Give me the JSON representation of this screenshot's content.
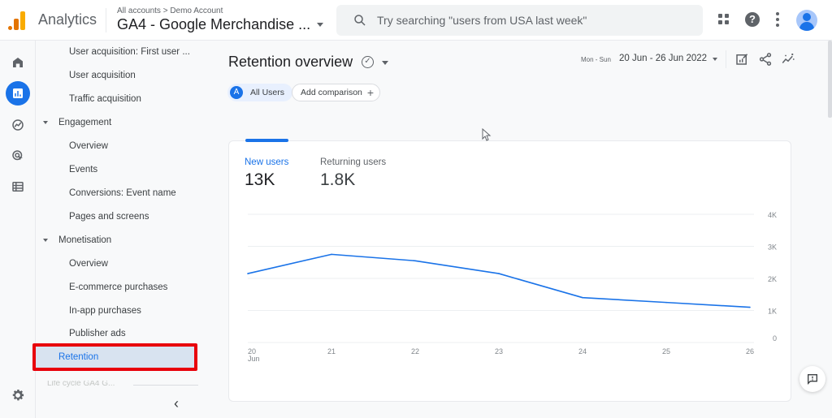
{
  "topbar": {
    "app_name": "Analytics",
    "breadcrumb": "All accounts > Demo Account",
    "property_name": "GA4 - Google Merchandise ...",
    "search_placeholder": "Try searching \"users from USA last week\"",
    "help_glyph": "?",
    "avatar_initial": ""
  },
  "rail": {
    "items": [
      {
        "icon": "home-icon",
        "label": "Home"
      },
      {
        "icon": "reports-icon",
        "label": "Reports",
        "active": true
      },
      {
        "icon": "explore-icon",
        "label": "Explore"
      },
      {
        "icon": "advertising-icon",
        "label": "Advertising"
      },
      {
        "icon": "configure-icon",
        "label": "Configure"
      }
    ],
    "settings_icon": "gear-icon"
  },
  "nav": {
    "items": [
      {
        "label": "User acquisition: First user ...",
        "type": "sub"
      },
      {
        "label": "User acquisition",
        "type": "sub"
      },
      {
        "label": "Traffic acquisition",
        "type": "sub"
      },
      {
        "label": "Engagement",
        "type": "section"
      },
      {
        "label": "Overview",
        "type": "sub"
      },
      {
        "label": "Events",
        "type": "sub"
      },
      {
        "label": "Conversions: Event name",
        "type": "sub"
      },
      {
        "label": "Pages and screens",
        "type": "sub"
      },
      {
        "label": "Monetisation",
        "type": "section"
      },
      {
        "label": "Overview",
        "type": "sub"
      },
      {
        "label": "E-commerce purchases",
        "type": "sub"
      },
      {
        "label": "In-app purchases",
        "type": "sub"
      },
      {
        "label": "Publisher ads",
        "type": "sub"
      },
      {
        "label": "Retention",
        "type": "active"
      }
    ],
    "faded_label": "Life cycle  GA4 G...",
    "collapse_glyph": "‹"
  },
  "main": {
    "title": "Retention overview",
    "title_check_glyph": "✓",
    "comparison_chip": {
      "badge": "A",
      "label": "All Users"
    },
    "add_comparison": {
      "label": "Add comparison",
      "glyph": "+"
    },
    "date_prefix": "Mon - Sun",
    "date_range": "20 Jun - 26 Jun 2022",
    "header_icons": [
      "customize-report-icon",
      "share-icon",
      "insights-icon"
    ]
  },
  "card": {
    "metrics": [
      {
        "label": "New users",
        "value": "13K",
        "active": true
      },
      {
        "label": "Returning users",
        "value": "1.8K",
        "active": false
      }
    ]
  },
  "chart_data": {
    "type": "line",
    "title": "",
    "xlabel": "",
    "ylabel": "",
    "categories": [
      "20",
      "21",
      "22",
      "23",
      "24",
      "25",
      "26"
    ],
    "x_sublabel": {
      "index": 0,
      "text": "Jun"
    },
    "series": [
      {
        "name": "New users",
        "color": "#1a73e8",
        "values": [
          2150,
          2750,
          2550,
          2150,
          1400,
          1250,
          1100
        ]
      }
    ],
    "ylim": [
      0,
      4000
    ],
    "y_ticks": [
      0,
      1000,
      2000,
      3000,
      4000
    ],
    "y_tick_labels": [
      "0",
      "1K",
      "2K",
      "3K",
      "4K"
    ],
    "y_axis_position": "right",
    "grid": true,
    "legend": "none"
  },
  "colors": {
    "accent": "#1a73e8",
    "highlight_box": "#e8000b",
    "active_nav_bg": "#d8e3f0"
  }
}
